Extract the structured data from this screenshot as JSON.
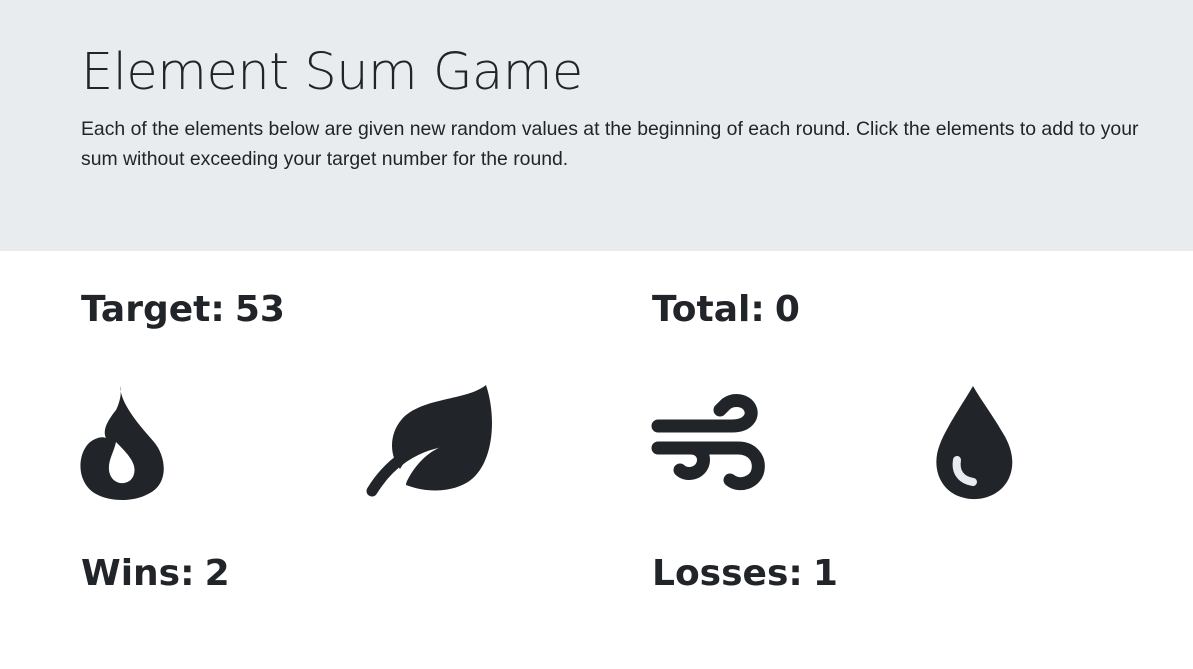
{
  "header": {
    "title": "Element Sum Game",
    "description": "Each of the elements below are given new random values at the beginning of each round. Click the elements to add to your sum without exceeding your target number for the round."
  },
  "stats": {
    "target_label": "Target:",
    "target_value": "53",
    "total_label": "Total:",
    "total_value": "0",
    "wins_label": "Wins:",
    "wins_value": "2",
    "losses_label": "Losses:",
    "losses_value": "1"
  },
  "elements": [
    {
      "name": "fire",
      "icon": "fire-icon"
    },
    {
      "name": "earth",
      "icon": "leaf-icon"
    },
    {
      "name": "air",
      "icon": "wind-icon"
    },
    {
      "name": "water",
      "icon": "droplet-icon"
    }
  ],
  "colors": {
    "header_background": "#e9ecef",
    "page_background": "#ffffff",
    "text": "#212529",
    "icon": "#212529"
  }
}
